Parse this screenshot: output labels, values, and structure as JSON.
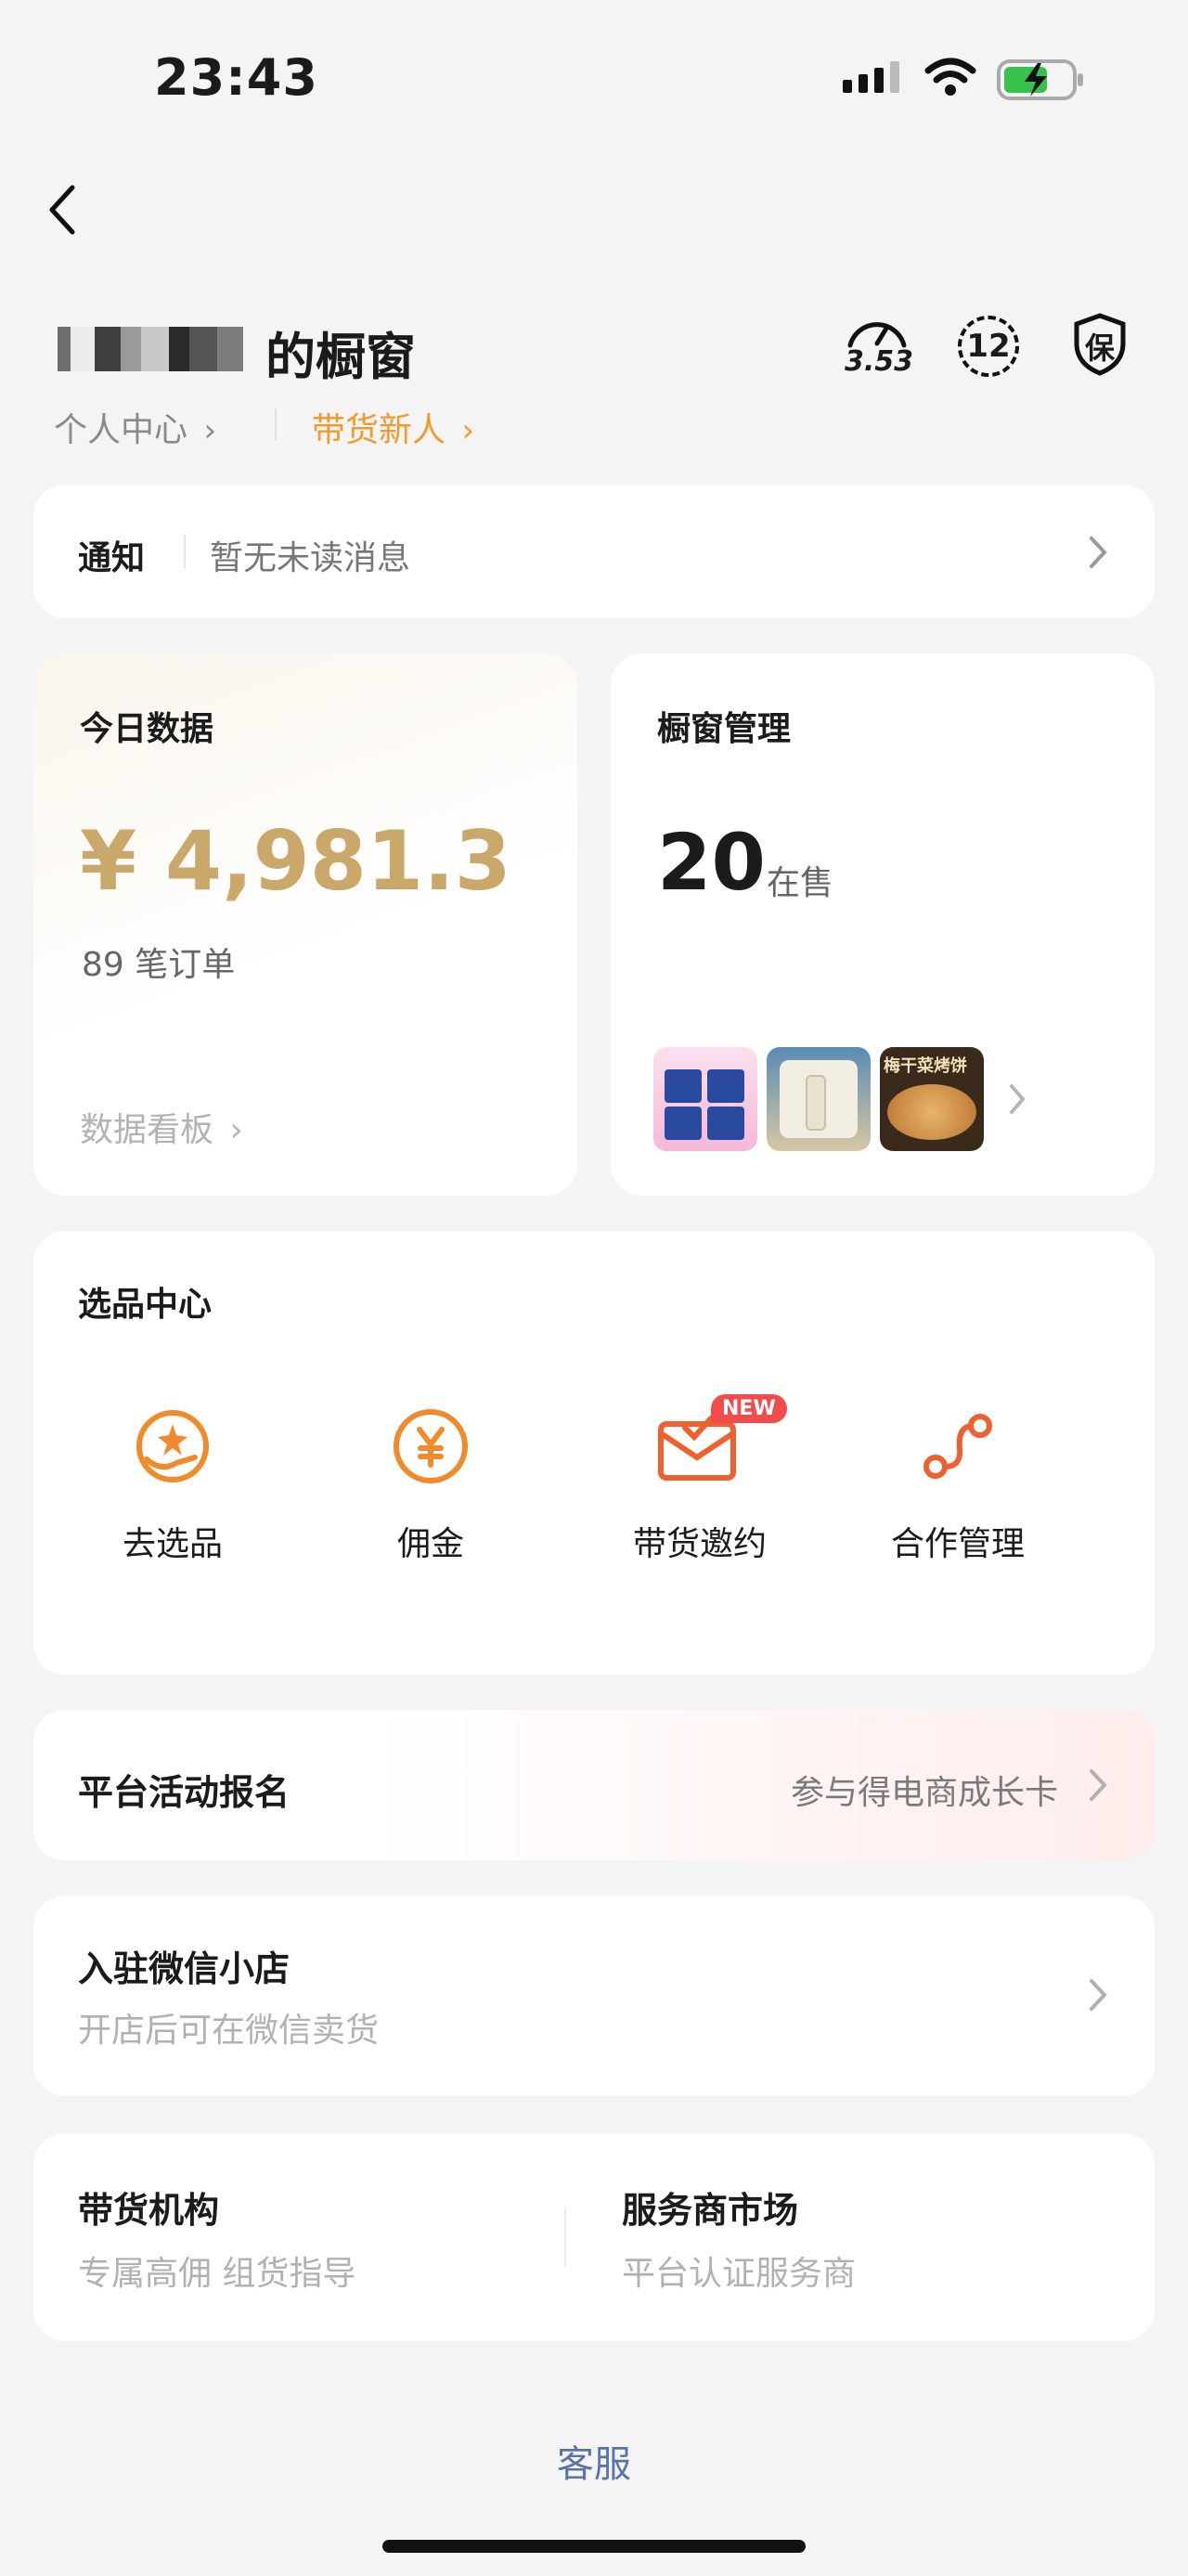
{
  "status_bar": {
    "time": "23:43"
  },
  "header": {
    "store_title": "的橱窗",
    "personal_center": "个人中心",
    "newbie": "带货新人",
    "score": "3.53",
    "badge_count": "12",
    "guarantee_label": "保"
  },
  "notice": {
    "label": "通知",
    "text": "暂无未读消息"
  },
  "today_data": {
    "title": "今日数据",
    "amount": "¥ 4,981.3",
    "orders": "89 笔订单",
    "dashboard_link": "数据看板"
  },
  "window_mgmt": {
    "title": "橱窗管理",
    "count": "20",
    "count_suffix": "在售",
    "thumb_3_text": "梅干菜烤饼"
  },
  "selection_center": {
    "title": "选品中心",
    "items": [
      {
        "label": "去选品",
        "icon": "hand-star-icon"
      },
      {
        "label": "佣金",
        "icon": "yen-coin-icon"
      },
      {
        "label": "带货邀约",
        "icon": "mail-check-icon",
        "badge": "NEW"
      },
      {
        "label": "合作管理",
        "icon": "route-icon"
      }
    ]
  },
  "platform_activity": {
    "title": "平台活动报名",
    "link": "参与得电商成长卡"
  },
  "wechat_shop": {
    "title": "入驻微信小店",
    "subtitle": "开店后可在微信卖货"
  },
  "bottom_grid": {
    "left_title": "带货机构",
    "left_subtitle": "专属高佣 组货指导",
    "right_title": "服务商市场",
    "right_subtitle": "平台认证服务商"
  },
  "footer": {
    "customer_service": "客服"
  },
  "colors": {
    "accent": "#f39a2c",
    "amount_gold": "#c9a86a",
    "icon_orange": "#f08a2a",
    "new_badge": "#f24b4b",
    "link_blue": "#5a73a8"
  }
}
